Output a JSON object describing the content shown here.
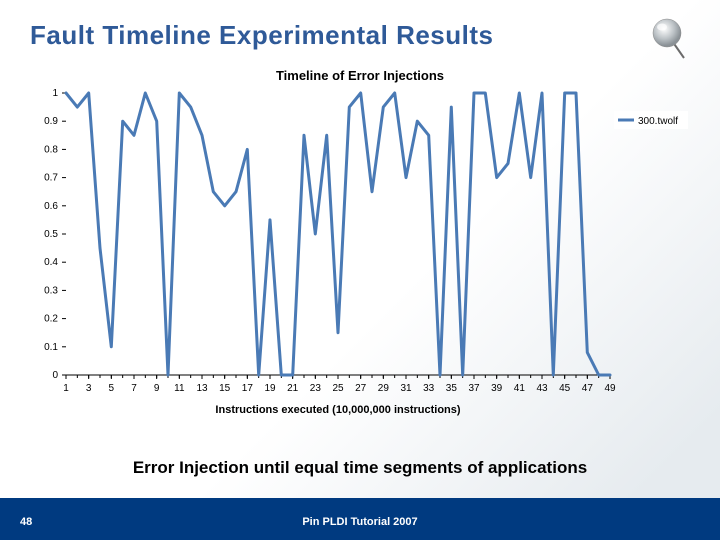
{
  "slide": {
    "title": "Fault Timeline Experimental Results",
    "caption": "Error Injection until equal time segments of applications",
    "page_number": "48",
    "footer_text": "Pin PLDI Tutorial 2007"
  },
  "chart_data": {
    "type": "line",
    "title": "Timeline of Error Injections",
    "xlabel": "Instructions executed (10,000,000 instructions)",
    "ylabel": "",
    "x": [
      1,
      2,
      3,
      4,
      5,
      6,
      7,
      8,
      9,
      10,
      11,
      12,
      13,
      14,
      15,
      16,
      17,
      18,
      19,
      20,
      21,
      22,
      23,
      24,
      25,
      26,
      27,
      28,
      29,
      30,
      31,
      32,
      33,
      34,
      35,
      36,
      37,
      38,
      39,
      40,
      41,
      42,
      43,
      44,
      45,
      46,
      47,
      48,
      49
    ],
    "series": [
      {
        "name": "300.twolf",
        "values": [
          1.0,
          0.95,
          1.0,
          0.45,
          0.1,
          0.9,
          0.85,
          1.0,
          0.9,
          0.0,
          1.0,
          0.95,
          0.85,
          0.65,
          0.6,
          0.65,
          0.8,
          0.0,
          0.55,
          0.0,
          0.0,
          0.85,
          0.5,
          0.85,
          0.15,
          0.95,
          1.0,
          0.65,
          0.95,
          1.0,
          0.7,
          0.9,
          0.85,
          0.0,
          0.95,
          0.0,
          1.0,
          1.0,
          0.7,
          0.75,
          1.0,
          0.7,
          1.0,
          0.0,
          1.0,
          1.0,
          0.08,
          0.0,
          0.0
        ]
      }
    ],
    "legend": [
      "300.twolf"
    ],
    "ylim": [
      0,
      1
    ],
    "x_ticks": [
      1,
      3,
      5,
      7,
      9,
      11,
      13,
      15,
      17,
      19,
      21,
      23,
      25,
      27,
      29,
      31,
      33,
      35,
      37,
      39,
      41,
      43,
      45,
      47,
      49
    ],
    "y_ticks": [
      0,
      0.1,
      0.2,
      0.3,
      0.4,
      0.5,
      0.6,
      0.7,
      0.8,
      0.9,
      1
    ]
  }
}
